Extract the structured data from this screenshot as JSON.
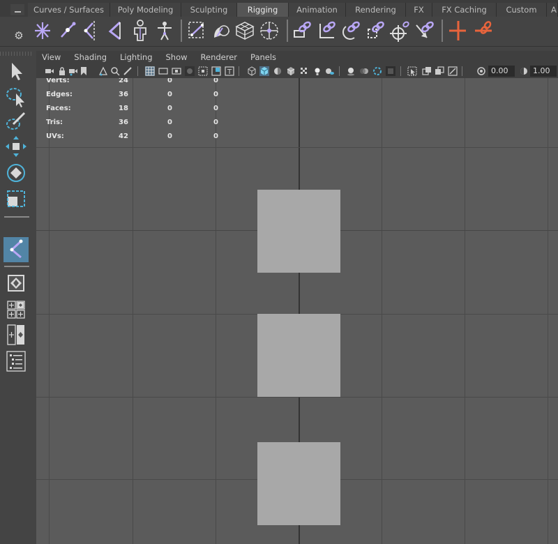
{
  "shelf": {
    "tabs": [
      {
        "label": "Curves / Surfaces",
        "active": false
      },
      {
        "label": "Poly Modeling",
        "active": false
      },
      {
        "label": "Sculpting",
        "active": false
      },
      {
        "label": "Rigging",
        "active": true
      },
      {
        "label": "Animation",
        "active": false
      },
      {
        "label": "Rendering",
        "active": false
      },
      {
        "label": "FX",
        "active": false
      },
      {
        "label": "FX Caching",
        "active": false
      },
      {
        "label": "Custom",
        "active": false
      },
      {
        "label": "Ar",
        "active": false
      }
    ],
    "icons": [
      "create-joints-icon",
      "insert-joint-icon",
      "mirror-joints-icon",
      "ik-handle-icon",
      "quick-rig-icon",
      "humanik-icon",
      "bind-skin-icon",
      "paint-skin-weights-icon",
      "create-lattice-icon",
      "create-cluster-icon",
      "parent-constraint-icon",
      "point-constraint-icon",
      "orient-constraint-icon",
      "scale-constraint-icon",
      "aim-constraint-icon",
      "pole-vector-constraint-icon",
      "create-blend-shape-icon",
      "add-influence-icon"
    ]
  },
  "toolbox": {
    "tools": [
      "select-tool-icon",
      "lasso-tool-icon",
      "paint-select-icon",
      "move-tool-icon",
      "rotate-tool-icon",
      "scale-tool-icon",
      "joint-tool-icon",
      "single-perspective-layout-icon",
      "four-view-layout-icon",
      "two-pane-layout-icon",
      "outliner-layout-icon"
    ]
  },
  "panel": {
    "menu": [
      "View",
      "Shading",
      "Lighting",
      "Show",
      "Renderer",
      "Panels"
    ],
    "exposure": "0.00",
    "gamma": "1.00"
  },
  "hud": {
    "rows": [
      {
        "label": "Verts:",
        "a": "24",
        "b": "0",
        "c": "0"
      },
      {
        "label": "Edges:",
        "a": "36",
        "b": "0",
        "c": "0"
      },
      {
        "label": "Faces:",
        "a": "18",
        "b": "0",
        "c": "0"
      },
      {
        "label": "Tris:",
        "a": "36",
        "b": "0",
        "c": "0"
      },
      {
        "label": "UVs:",
        "a": "42",
        "b": "0",
        "c": "0"
      }
    ]
  },
  "colors": {
    "accent": "#5285a6",
    "joint": "#b9a7f5",
    "constraint": "#e8643c",
    "cube": "#a8a8a8"
  }
}
